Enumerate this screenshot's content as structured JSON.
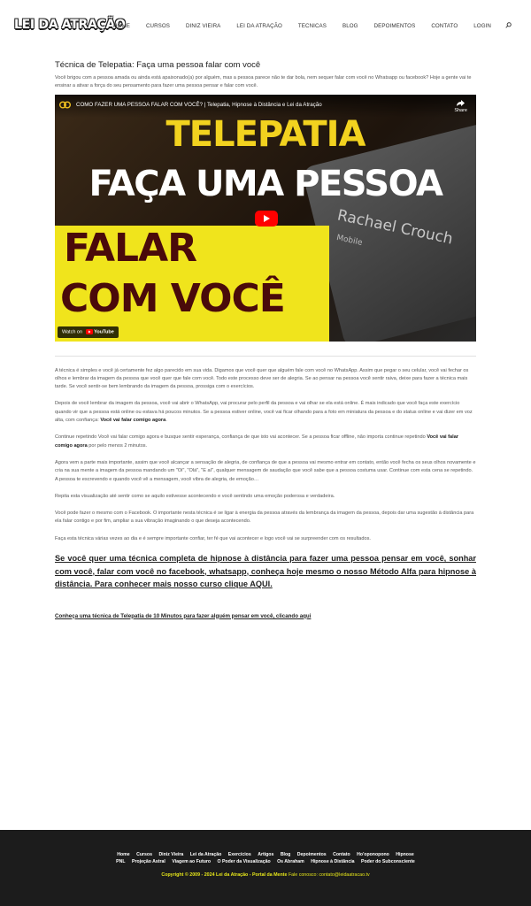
{
  "header": {
    "logo": "LEI DA ATRAÇÃO",
    "nav": [
      "HOME",
      "CURSOS",
      "DINIZ VIEIRA",
      "LEI DA ATRAÇÃO",
      "TECNICAS",
      "BLOG",
      "DEPOIMENTOS",
      "CONTATO",
      "LOGIN"
    ],
    "search_icon": "search-icon"
  },
  "post": {
    "title": "Técnica de Telepatia: Faça uma pessoa falar com você",
    "intro": "Você brigou com a pessoa amada ou ainda está apaixonado(a) por alguém, mas a pessoa parece não te dar bola, nem sequer falar com você no Whatsapp ou facebook? Hoje a gente vai te ensinar a ativar a força do seu pensamento para fazer uma pessoa pensar e falar com você.",
    "video": {
      "title": "COMO FAZER UMA PESSOA FALAR COM VOCÊ? | Telepatia, Hipnose à Distância e Lei da Atração",
      "share": "Share",
      "watch_on": "Watch on",
      "youtube": "YouTube",
      "line1": "TELEPATIA",
      "line2": "FAÇA UMA PESSOA",
      "line3": "FALAR",
      "line4": "COM VOCÊ",
      "phone_name": "Rachael Crouch",
      "phone_sub": "Mobile"
    },
    "p1": "A técnica é simples e você já certamente fez algo parecido em sua vida. Digamos que você quer que alguém fale com você no WhatsApp. Assim que pegar o seu celular, você vai fechar os olhos e lembrar da imagem da pessoa que você quer que fale com você. Todo este processo deve ser de alegria. Se ao pensar na pessoa você sentir raiva, deixe para fazer a técnica mais tarde. Se você sentir-se bem lembrando da imagem da pessoa, prossiga com o exercícios.",
    "p2_a": "Depois de você lembrar da imagem da pessoa, você vai abrir o WhatsApp, vai procurar pelo perfil da pessoa e vai olhar se ela está online. É mais indicado que você faça este exercício quando vir que a pessoa está online ou estava há poucos minutos. Se a pessoa estiver online, você vai ficar olhando para a foto em miniatura da pessoa e do status online e vai dizer em voz alta, com confiança: ",
    "p2_b": "Você vai falar comigo agora",
    "p2_c": ".",
    "p3_a": "Continue repetindo Você vai falar comigo agora e busque sentir esperança, confiança de que isto vai acontecer. Se a pessoa ficar offline, não importa continue repetindo ",
    "p3_b": "Você vai falar comigo agora",
    "p3_c": " por pelo menos 2 minutos.",
    "p4": "Agora vem a parte mais importante, assim que você alcançar a sensação de alegria, de confiança de que a pessoa vai mesmo entrar em contato, então você fecha os seus olhos novamente e cria na sua mente a imagem da pessoa mandando um \"Oi\", \"Olá\", \"E aí\", qualquer mensagem de saudação que você sabe que a pessoa costuma usar. Continue com esta cena se repetindo. A pessoa te escrevendo e quando você vê a mensagem, você vibra de alegria, de emoção…",
    "p5": "Repita esta visualização até sentir como se aquilo estivesse acontecendo e você sentindo uma emoção poderosa e verdadeira.",
    "p6": "Você pode fazer o mesmo com o Facebook. O importante nesta técnica é se ligar à energia da pessoa através da lembrança da imagem da pessoa, depois dar uma sugestão à distância para ela falar contigo e por fim, ampliar a sua vibração imaginando o que deseja acontecendo.",
    "p7": "Faça esta técnica várias vezes ao dia e é sempre importante confiar, ter fé que vai acontecer e logo você vai se surpreender com os resultados.",
    "cta": "Se você quer uma técnica completa de hipnose à distância para fazer uma pessoa pensar em você, sonhar com você, falar com você no facebook, whatsapp, conheça hoje mesmo o nosso Método Alfa para hipnose à distância. Para conhecer mais nosso curso clique AQUI.",
    "link": "Conheça uma técnica de Telepatia de 10 Minutos para fazer alguém pensar em você, clicando aqui"
  },
  "footer": {
    "row1": [
      "Home",
      "Cursos",
      "Diniz Vieira",
      "Lei da Atração",
      "Exercícios",
      "Artigos",
      "Blog",
      "Depoimentos",
      "Contato",
      "Ho'oponopono",
      "Hipnose"
    ],
    "row2": [
      "PNL",
      "Projeção Astral",
      "Viagem ao Futuro",
      "O Poder da Visualização",
      "Os Abraham",
      "Hipnose à Distância",
      "Poder do Subconsciente"
    ],
    "copyright": "Copyright © 2009 - 2024 Lei da Atração - Portal da Mente",
    "contact_label": "Fale conosco:",
    "contact_email": "contato@leidaatracao.tv"
  }
}
